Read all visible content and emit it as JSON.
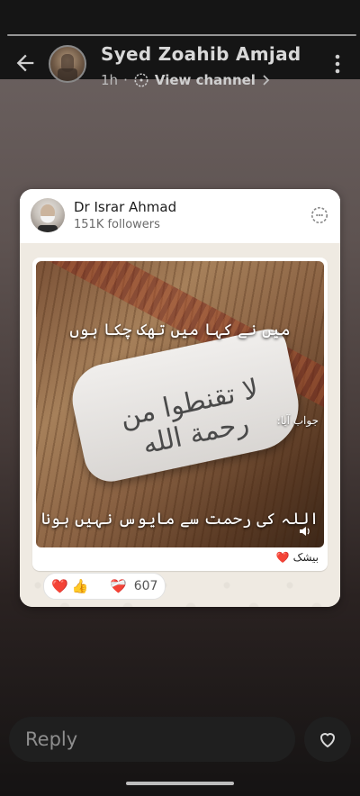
{
  "status": {
    "channel_name": "Syed Zoahib Amjad",
    "time_ago": "1h",
    "view_channel": "View channel"
  },
  "forwarded_post": {
    "source_name": "Dr Israr Ahmad",
    "source_followers": "151K followers",
    "image_text_top": "میں نے کہا میں تھک چکا ہوں",
    "image_text_mid": "جواب آیا:",
    "image_text_paper": "لا تقنطوا من رحمة الله",
    "image_text_bottom": "اللہ کی رحمت سے مایوس نہیں ہونا",
    "caption": "بیشک",
    "caption_emoji": "❤️",
    "reactions": [
      "❤️",
      "👍",
      "😢",
      "❤️‍🩹"
    ],
    "reaction_count": "607"
  },
  "footer": {
    "reply_placeholder": "Reply"
  },
  "colors": {
    "topbar": "#151515",
    "card_bg": "#ffffff",
    "chat_bg": "#efeae2",
    "reply_bar": "#1f1f1f"
  },
  "icons": {
    "back": "arrow-left-icon",
    "menu": "kebab-menu-icon",
    "channel": "channel-icon",
    "chevron": "chevron-right-icon",
    "forward": "channel-forward-icon",
    "speaker": "speaker-icon",
    "heart": "heart-outline-icon"
  }
}
